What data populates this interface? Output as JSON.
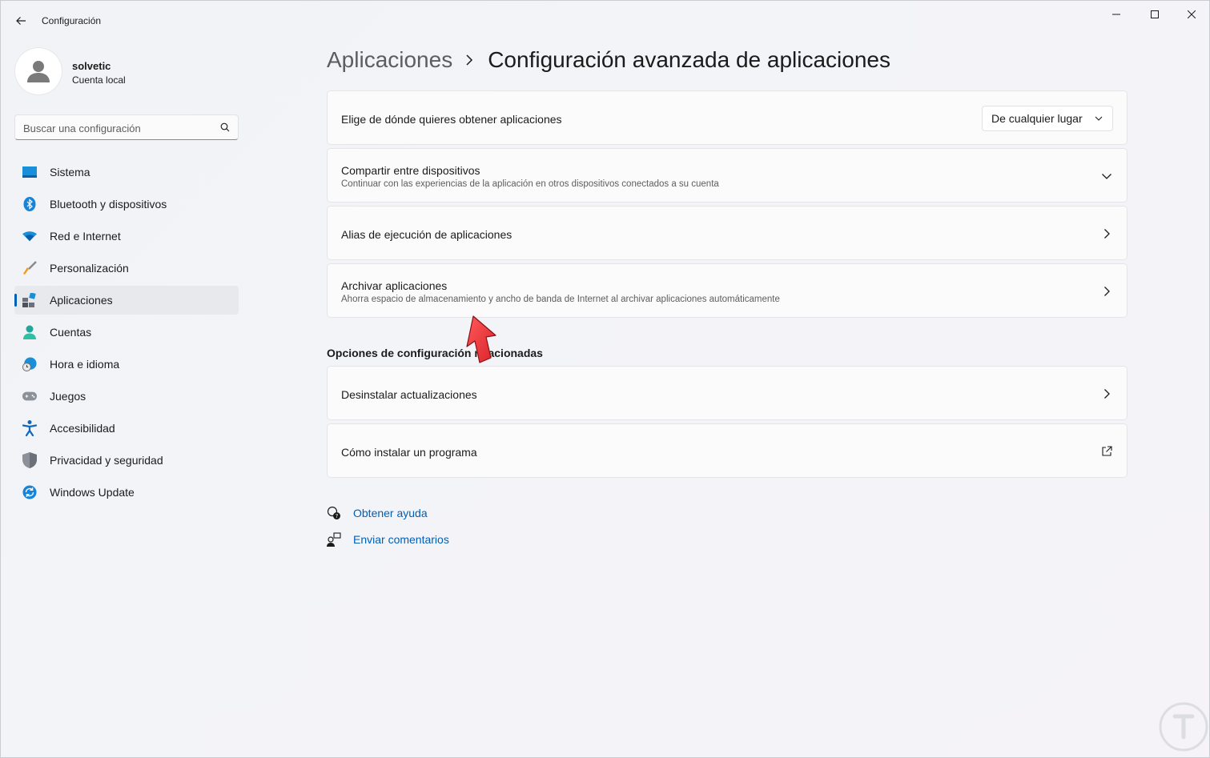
{
  "window": {
    "title": "Configuración"
  },
  "profile": {
    "name": "solvetic",
    "subtitle": "Cuenta local"
  },
  "search": {
    "placeholder": "Buscar una configuración"
  },
  "sidebar": {
    "items": [
      {
        "label": "Sistema",
        "icon": "system-icon"
      },
      {
        "label": "Bluetooth y dispositivos",
        "icon": "bluetooth-icon"
      },
      {
        "label": "Red e Internet",
        "icon": "wifi-icon"
      },
      {
        "label": "Personalización",
        "icon": "brush-icon"
      },
      {
        "label": "Aplicaciones",
        "icon": "apps-icon",
        "active": true
      },
      {
        "label": "Cuentas",
        "icon": "accounts-icon"
      },
      {
        "label": "Hora e idioma",
        "icon": "time-language-icon"
      },
      {
        "label": "Juegos",
        "icon": "gamepad-icon"
      },
      {
        "label": "Accesibilidad",
        "icon": "accessibility-icon"
      },
      {
        "label": "Privacidad y seguridad",
        "icon": "shield-icon"
      },
      {
        "label": "Windows Update",
        "icon": "update-icon"
      }
    ]
  },
  "breadcrumb": {
    "parent": "Aplicaciones",
    "current": "Configuración avanzada de aplicaciones"
  },
  "settings": {
    "source": {
      "title": "Elige de dónde quieres obtener aplicaciones",
      "dropdown_value": "De cualquier lugar"
    },
    "share": {
      "title": "Compartir entre dispositivos",
      "subtitle": "Continuar con las experiencias de la aplicación en otros dispositivos conectados a su cuenta"
    },
    "alias": {
      "title": "Alias de ejecución de aplicaciones"
    },
    "archive": {
      "title": "Archivar aplicaciones",
      "subtitle": "Ahorra espacio de almacenamiento y ancho de banda de Internet al archivar aplicaciones automáticamente"
    }
  },
  "related": {
    "title": "Opciones de configuración relacionadas",
    "uninstall_updates": "Desinstalar actualizaciones",
    "how_to_install": "Cómo instalar un programa"
  },
  "help": {
    "get_help": "Obtener ayuda",
    "feedback": "Enviar comentarios"
  },
  "colors": {
    "accent": "#005fb8",
    "pointer_arrow": "#e8343b"
  }
}
